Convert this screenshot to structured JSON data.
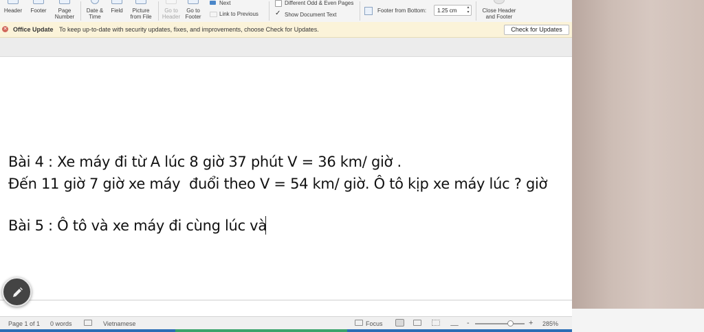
{
  "ribbon": {
    "header": "Header",
    "footer": "Footer",
    "page_number": "Page Number",
    "page_number_l1": "Page",
    "page_number_l2": "Number",
    "date_time_l1": "Date &",
    "date_time_l2": "Time",
    "field": "Field",
    "picture_l1": "Picture",
    "picture_l2": "from File",
    "goto_header_l1": "Go to",
    "goto_header_l2": "Header",
    "goto_footer_l1": "Go to",
    "goto_footer_l2": "Footer",
    "next": "Next",
    "link_previous": "Link to Previous",
    "different_odd_even": "Different Odd & Even Pages",
    "show_document_text": "Show Document Text",
    "footer_from_bottom_label": "Footer from Bottom:",
    "footer_from_bottom_value": "1.25 cm",
    "close_l1": "Close Header",
    "close_l2": "and Footer"
  },
  "message_bar": {
    "title": "Office Update",
    "text": "To keep up-to-date with security updates, fixes, and improvements, choose Check for Updates.",
    "button": "Check for Updates"
  },
  "document": {
    "lines": [
      "Bài 4 : Xe máy đi từ A lúc 8 giờ 37 phút V = 36 km/ giờ .",
      "Đến 11 giờ 7 giờ xe máy  đuổi theo V = 54 km/ giờ. Ô tô kịp xe máy lúc ? giờ",
      "Bài 5 : Ô tô và xe máy đi cùng lúc và"
    ]
  },
  "status_bar": {
    "page": "Page 1 of 1",
    "words": "0 words",
    "language": "Vietnamese",
    "focus": "Focus",
    "zoom_out": "-",
    "zoom_in": "+",
    "zoom_level": "285%",
    "zoom_fraction": 0.72
  },
  "colors": {
    "message_bar_bg": "#fbf3d9",
    "accent_blue": "#2a6db5"
  }
}
